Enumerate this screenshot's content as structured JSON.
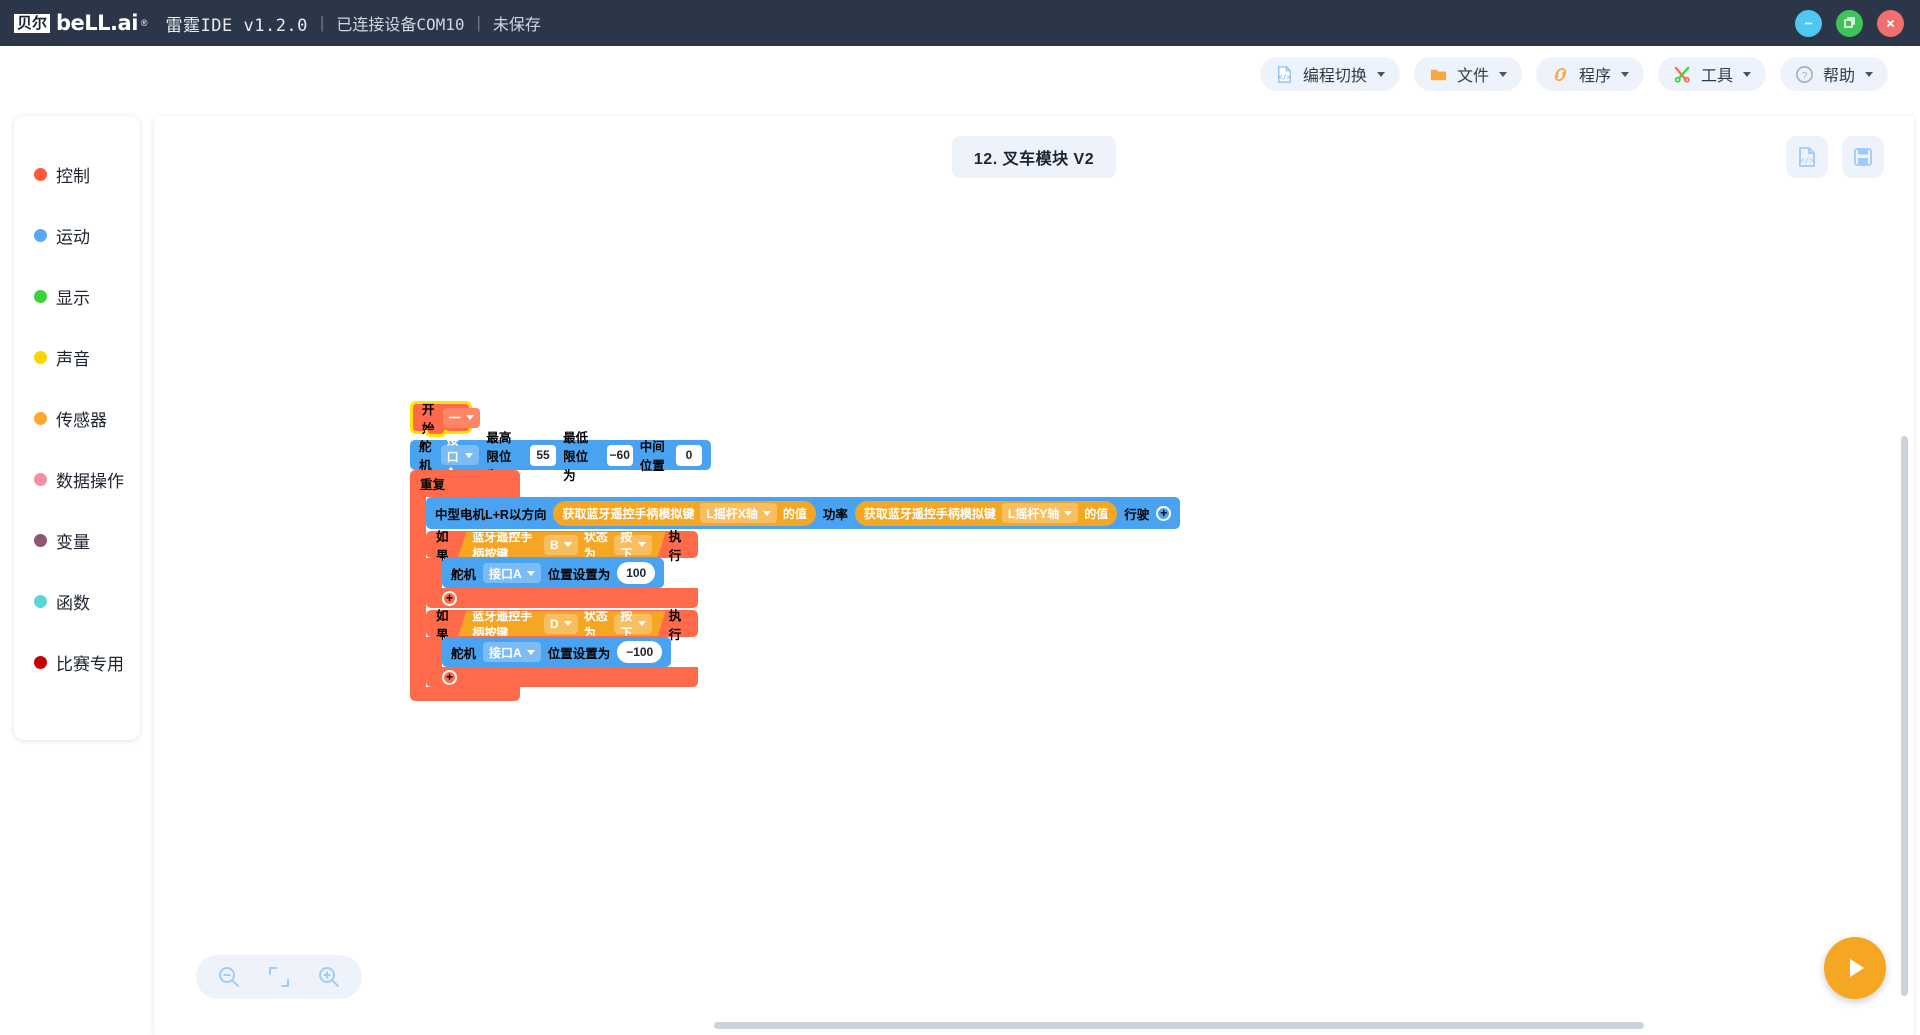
{
  "titlebar": {
    "brand_cn": "贝尔",
    "brand_en": "beLL.ai",
    "app_title": "雷霆IDE v1.2.0",
    "sep": "|",
    "device_status": "已连接设备COM10",
    "save_status": "未保存",
    "window_buttons": [
      {
        "name": "minimize",
        "icon": "minus-icon",
        "color": "#4ec8f0"
      },
      {
        "name": "maximize",
        "icon": "restore-icon",
        "color": "#3fc35a"
      },
      {
        "name": "close",
        "icon": "close-icon",
        "color": "#f07070"
      }
    ]
  },
  "toolbar": {
    "items": [
      {
        "label": "编程切换",
        "icon": "code-file-icon"
      },
      {
        "label": "文件",
        "icon": "folder-icon"
      },
      {
        "label": "程序",
        "icon": "link-icon"
      },
      {
        "label": "工具",
        "icon": "tools-icon"
      },
      {
        "label": "帮助",
        "icon": "help-icon"
      }
    ]
  },
  "sidebar": {
    "items": [
      {
        "label": "控制",
        "color": "#ff5a3c"
      },
      {
        "label": "运动",
        "color": "#5ba7f7"
      },
      {
        "label": "显示",
        "color": "#3ad43a"
      },
      {
        "label": "声音",
        "color": "#ffd400"
      },
      {
        "label": "传感器",
        "color": "#ffa82e"
      },
      {
        "label": "数据操作",
        "color": "#f58fa0"
      },
      {
        "label": "变量",
        "color": "#8e5670"
      },
      {
        "label": "函数",
        "color": "#5bd6d6"
      },
      {
        "label": "比赛专用",
        "color": "#c40000"
      }
    ]
  },
  "canvas": {
    "tab_label": "12. 叉车模块 V2",
    "corner_buttons": [
      {
        "name": "view-code-button",
        "icon": "code-file-icon"
      },
      {
        "name": "save-button",
        "icon": "floppy-save-icon"
      }
    ],
    "zoom_controls": [
      {
        "name": "zoom-out-button",
        "icon": "zoom-out-icon"
      },
      {
        "name": "fit-screen-button",
        "icon": "fit-screen-icon"
      },
      {
        "name": "zoom-in-button",
        "icon": "zoom-in-icon"
      }
    ],
    "run_button": {
      "name": "run-button",
      "icon": "play-icon",
      "color": "#f5a623"
    }
  },
  "program": {
    "hat": {
      "label": "开始",
      "dropdown_value": "一"
    },
    "servo_init": {
      "label": "舵机",
      "port": "接口A",
      "max_label": "最高限位为",
      "max_value": "55",
      "min_label": "最低限位为",
      "min_value": "−60",
      "mid_label": "中间位置",
      "mid_value": "0"
    },
    "repeat": {
      "label": "重复"
    },
    "drive": {
      "label": "中型电机L+R以方向",
      "dir_reporter": {
        "label": "获取蓝牙遥控手柄模拟键",
        "axis": "L摇杆X轴",
        "suffix": "的值"
      },
      "power_label": "功率",
      "power_reporter": {
        "label": "获取蓝牙遥控手柄模拟键",
        "axis": "L摇杆Y轴",
        "suffix": "的值"
      },
      "tail_label": "行驶",
      "plus": "+"
    },
    "if_blocks": [
      {
        "if_label": "如果",
        "cond_label": "蓝牙遥控手柄按键",
        "button": "B",
        "state_label": "状态为",
        "state": "按下",
        "then_label": "执行",
        "body": {
          "label": "舵机",
          "port": "接口A",
          "action": "位置设置为",
          "value": "100"
        },
        "plus": "+"
      },
      {
        "if_label": "如果",
        "cond_label": "蓝牙遥控手柄按键",
        "button": "D",
        "state_label": "状态为",
        "state": "按下",
        "then_label": "执行",
        "body": {
          "label": "舵机",
          "port": "接口A",
          "action": "位置设置为",
          "value": "−100"
        },
        "plus": "+"
      }
    ]
  }
}
